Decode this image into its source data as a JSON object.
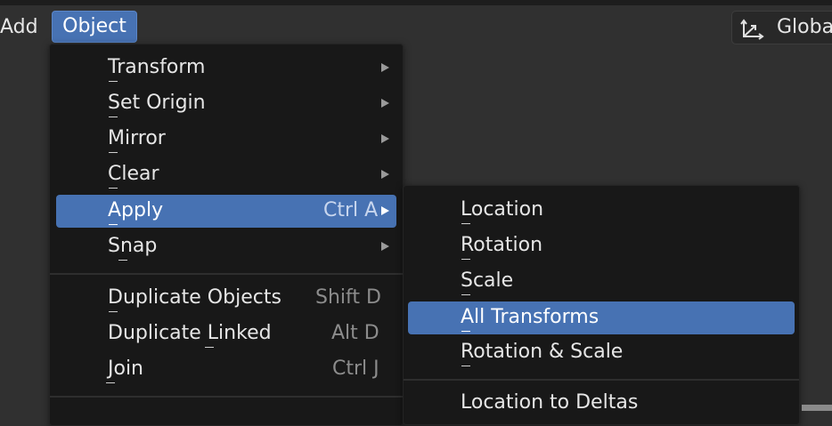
{
  "header": {
    "add_label": "Add",
    "object_label": "Object",
    "orientation_label": "Global"
  },
  "object_menu": {
    "items": [
      {
        "label": "Transform",
        "shortcut": "",
        "submenu": true
      },
      {
        "label": "Set Origin",
        "shortcut": "",
        "submenu": true
      },
      {
        "label": "Mirror",
        "shortcut": "",
        "submenu": true
      },
      {
        "label": "Clear",
        "shortcut": "",
        "submenu": true
      },
      {
        "label": "Apply",
        "shortcut": "Ctrl A",
        "submenu": true,
        "highlighted": true
      },
      {
        "label": "Snap",
        "shortcut": "",
        "submenu": true
      },
      {
        "label": "Duplicate Objects",
        "shortcut": "Shift D"
      },
      {
        "label": "Duplicate Linked",
        "shortcut": "Alt D"
      },
      {
        "label": "Join",
        "shortcut": "Ctrl J"
      }
    ]
  },
  "apply_submenu": {
    "items": [
      {
        "label": "Location"
      },
      {
        "label": "Rotation"
      },
      {
        "label": "Scale"
      },
      {
        "label": "All Transforms",
        "highlighted": true
      },
      {
        "label": "Rotation & Scale"
      },
      {
        "label": "Location to Deltas"
      }
    ]
  },
  "colors": {
    "accent": "#4772b3",
    "menu_bg": "#181818",
    "header_bg": "#303030"
  }
}
